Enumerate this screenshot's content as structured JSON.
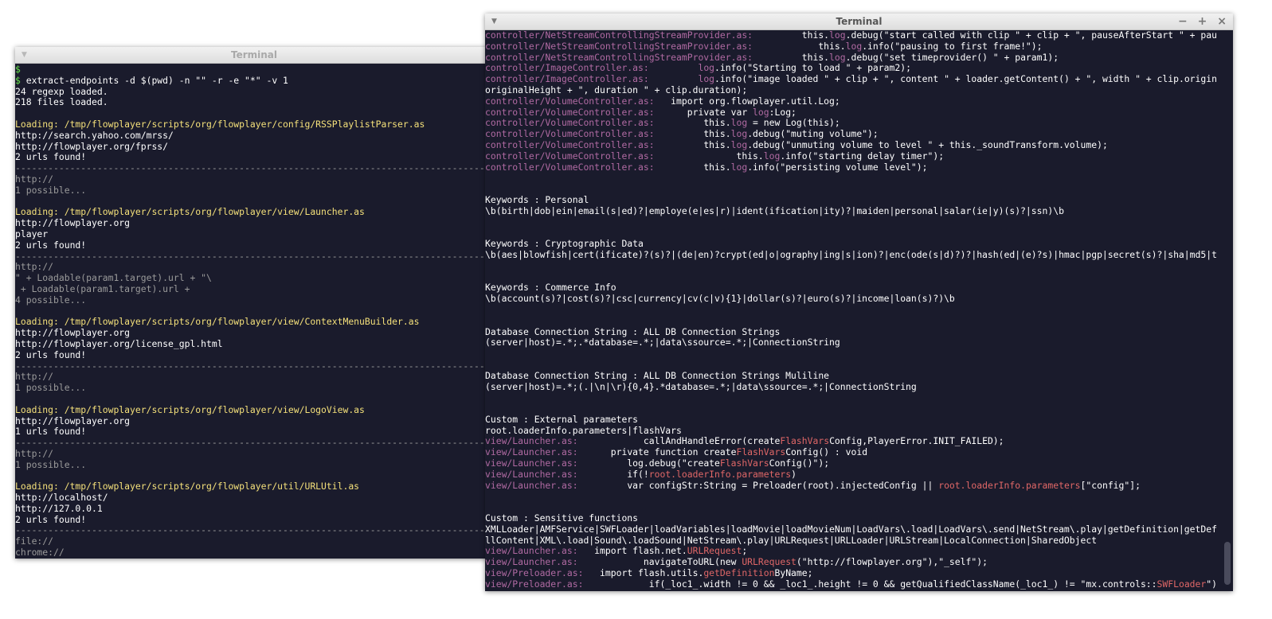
{
  "left_window": {
    "title": "Terminal",
    "lines": [
      {
        "segs": [
          {
            "t": "$",
            "c": "gr"
          }
        ]
      },
      {
        "segs": [
          {
            "t": "$",
            "c": "gr"
          },
          {
            "t": " extract-endpoints -d $(pwd) -n \"\" -r -e \"*\" -v 1"
          }
        ]
      },
      {
        "segs": [
          {
            "t": "24 regexp loaded."
          }
        ]
      },
      {
        "segs": [
          {
            "t": "218 files loaded."
          }
        ]
      },
      {
        "segs": [
          {
            "t": ""
          }
        ]
      },
      {
        "segs": [
          {
            "t": "Loading: /tmp/flowplayer/scripts/org/flowplayer/config/RSSPlaylistParser.as",
            "c": "y"
          }
        ]
      },
      {
        "segs": [
          {
            "t": "http://search.yahoo.com/mrss/"
          }
        ]
      },
      {
        "segs": [
          {
            "t": "http://flowplayer.org/fprss/"
          }
        ]
      },
      {
        "segs": [
          {
            "t": "2 urls found!"
          }
        ]
      },
      {
        "segs": [
          {
            "t": "--------------------------------------------------------------------------------------------------",
            "c": "g"
          }
        ]
      },
      {
        "segs": [
          {
            "t": "http://",
            "c": "g"
          }
        ]
      },
      {
        "segs": [
          {
            "t": "1 possible...",
            "c": "g"
          }
        ]
      },
      {
        "segs": [
          {
            "t": ""
          }
        ]
      },
      {
        "segs": [
          {
            "t": "Loading: /tmp/flowplayer/scripts/org/flowplayer/view/Launcher.as",
            "c": "y"
          }
        ]
      },
      {
        "segs": [
          {
            "t": "http://flowplayer.org"
          }
        ]
      },
      {
        "segs": [
          {
            "t": "player"
          }
        ]
      },
      {
        "segs": [
          {
            "t": "2 urls found!"
          }
        ]
      },
      {
        "segs": [
          {
            "t": "--------------------------------------------------------------------------------------------------",
            "c": "g"
          }
        ]
      },
      {
        "segs": [
          {
            "t": "http://",
            "c": "g"
          }
        ]
      },
      {
        "segs": [
          {
            "t": "\" + Loadable(param1.target).url + \"\\",
            "c": "g"
          }
        ]
      },
      {
        "segs": [
          {
            "t": " + Loadable(param1.target).url +",
            "c": "g"
          }
        ]
      },
      {
        "segs": [
          {
            "t": "4 possible...",
            "c": "g"
          }
        ]
      },
      {
        "segs": [
          {
            "t": ""
          }
        ]
      },
      {
        "segs": [
          {
            "t": "Loading: /tmp/flowplayer/scripts/org/flowplayer/view/ContextMenuBuilder.as",
            "c": "y"
          }
        ]
      },
      {
        "segs": [
          {
            "t": "http://flowplayer.org"
          }
        ]
      },
      {
        "segs": [
          {
            "t": "http://flowplayer.org/license_gpl.html"
          }
        ]
      },
      {
        "segs": [
          {
            "t": "2 urls found!"
          }
        ]
      },
      {
        "segs": [
          {
            "t": "--------------------------------------------------------------------------------------------------",
            "c": "g"
          }
        ]
      },
      {
        "segs": [
          {
            "t": "http://",
            "c": "g"
          }
        ]
      },
      {
        "segs": [
          {
            "t": "1 possible...",
            "c": "g"
          }
        ]
      },
      {
        "segs": [
          {
            "t": ""
          }
        ]
      },
      {
        "segs": [
          {
            "t": "Loading: /tmp/flowplayer/scripts/org/flowplayer/view/LogoView.as",
            "c": "y"
          }
        ]
      },
      {
        "segs": [
          {
            "t": "http://flowplayer.org"
          }
        ]
      },
      {
        "segs": [
          {
            "t": "1 urls found!"
          }
        ]
      },
      {
        "segs": [
          {
            "t": "--------------------------------------------------------------------------------------------------",
            "c": "g"
          }
        ]
      },
      {
        "segs": [
          {
            "t": "http://",
            "c": "g"
          }
        ]
      },
      {
        "segs": [
          {
            "t": "1 possible...",
            "c": "g"
          }
        ]
      },
      {
        "segs": [
          {
            "t": ""
          }
        ]
      },
      {
        "segs": [
          {
            "t": "Loading: /tmp/flowplayer/scripts/org/flowplayer/util/URLUtil.as",
            "c": "y"
          }
        ]
      },
      {
        "segs": [
          {
            "t": "http://localhost/"
          }
        ]
      },
      {
        "segs": [
          {
            "t": "http://127.0.0.1"
          }
        ]
      },
      {
        "segs": [
          {
            "t": "2 urls found!"
          }
        ]
      },
      {
        "segs": [
          {
            "t": "--------------------------------------------------------------------------------------------------",
            "c": "g"
          }
        ]
      },
      {
        "segs": [
          {
            "t": "file://",
            "c": "g"
          }
        ]
      },
      {
        "segs": [
          {
            "t": "chrome://",
            "c": "g"
          }
        ]
      }
    ]
  },
  "right_window": {
    "title": "Terminal",
    "controls": {
      "minimize": "−",
      "maximize": "+",
      "close": "×"
    },
    "lines": [
      {
        "segs": [
          {
            "t": "controller/NetStreamControllingStreamProvider.as:",
            "c": "m"
          },
          {
            "t": "         this."
          },
          {
            "t": "log",
            "c": "m"
          },
          {
            "t": ".debug(\"start called with clip \" + clip + \", pauseAfterStart \" + pau"
          }
        ]
      },
      {
        "segs": [
          {
            "t": "controller/NetStreamControllingStreamProvider.as:",
            "c": "m"
          },
          {
            "t": "            this."
          },
          {
            "t": "log",
            "c": "m"
          },
          {
            "t": ".info(\"pausing to first frame!\");"
          }
        ]
      },
      {
        "segs": [
          {
            "t": "controller/NetStreamControllingStreamProvider.as:",
            "c": "m"
          },
          {
            "t": "         this."
          },
          {
            "t": "log",
            "c": "m"
          },
          {
            "t": ".debug(\"set timeprovider() \" + param1);"
          }
        ]
      },
      {
        "segs": [
          {
            "t": "controller/ImageController.as:",
            "c": "m"
          },
          {
            "t": "         "
          },
          {
            "t": "log",
            "c": "m"
          },
          {
            "t": ".info(\"Starting to load \" + param2);"
          }
        ]
      },
      {
        "segs": [
          {
            "t": "controller/ImageController.as:",
            "c": "m"
          },
          {
            "t": "         "
          },
          {
            "t": "log",
            "c": "m"
          },
          {
            "t": ".info(\"image loaded \" + clip + \", content \" + loader.getContent() + \", width \" + clip.origin"
          }
        ]
      },
      {
        "segs": [
          {
            "t": "originalHeight + \", duration \" + clip.duration);"
          }
        ]
      },
      {
        "segs": [
          {
            "t": "controller/VolumeController.as:",
            "c": "m"
          },
          {
            "t": "   import org.flowplayer.util.Log;"
          }
        ]
      },
      {
        "segs": [
          {
            "t": "controller/VolumeController.as:",
            "c": "m"
          },
          {
            "t": "      private var "
          },
          {
            "t": "log",
            "c": "m"
          },
          {
            "t": ":Log;"
          }
        ]
      },
      {
        "segs": [
          {
            "t": "controller/VolumeController.as:",
            "c": "m"
          },
          {
            "t": "         this."
          },
          {
            "t": "log",
            "c": "m"
          },
          {
            "t": " = new Log(this);"
          }
        ]
      },
      {
        "segs": [
          {
            "t": "controller/VolumeController.as:",
            "c": "m"
          },
          {
            "t": "         this."
          },
          {
            "t": "log",
            "c": "m"
          },
          {
            "t": ".debug(\"muting volume\");"
          }
        ]
      },
      {
        "segs": [
          {
            "t": "controller/VolumeController.as:",
            "c": "m"
          },
          {
            "t": "         this."
          },
          {
            "t": "log",
            "c": "m"
          },
          {
            "t": ".debug(\"unmuting volume to level \" + this._soundTransform.volume);"
          }
        ]
      },
      {
        "segs": [
          {
            "t": "controller/VolumeController.as:",
            "c": "m"
          },
          {
            "t": "               this."
          },
          {
            "t": "log",
            "c": "m"
          },
          {
            "t": ".info(\"starting delay timer\");"
          }
        ]
      },
      {
        "segs": [
          {
            "t": "controller/VolumeController.as:",
            "c": "m"
          },
          {
            "t": "         this."
          },
          {
            "t": "log",
            "c": "m"
          },
          {
            "t": ".info(\"persisting volume level\");"
          }
        ]
      },
      {
        "segs": [
          {
            "t": ""
          }
        ]
      },
      {
        "segs": [
          {
            "t": ""
          }
        ]
      },
      {
        "segs": [
          {
            "t": "Keywords : Personal"
          }
        ]
      },
      {
        "segs": [
          {
            "t": "\\b(birth|dob|ein|email(s|ed)?|employe(e|es|r)|ident(ification|ity)?|maiden|personal|salar(ie|y)(s)?|ssn)\\b"
          }
        ]
      },
      {
        "segs": [
          {
            "t": ""
          }
        ]
      },
      {
        "segs": [
          {
            "t": ""
          }
        ]
      },
      {
        "segs": [
          {
            "t": "Keywords : Cryptographic Data"
          }
        ]
      },
      {
        "segs": [
          {
            "t": "\\b(aes|blowfish|cert(ificate)?(s)?|(de|en)?crypt(ed|o|ography|ing|s|ion)?|enc(ode(s|d)?)?|hash(ed|(e)?s)|hmac|pgp|secret(s)?|sha|md5|t"
          }
        ]
      },
      {
        "segs": [
          {
            "t": ""
          }
        ]
      },
      {
        "segs": [
          {
            "t": ""
          }
        ]
      },
      {
        "segs": [
          {
            "t": "Keywords : Commerce Info"
          }
        ]
      },
      {
        "segs": [
          {
            "t": "\\b(account(s)?|cost(s)?|csc|currency|cv(c|v){1}|dollar(s)?|euro(s)?|income|loan(s)?)\\b"
          }
        ]
      },
      {
        "segs": [
          {
            "t": ""
          }
        ]
      },
      {
        "segs": [
          {
            "t": ""
          }
        ]
      },
      {
        "segs": [
          {
            "t": "Database Connection String : ALL DB Connection Strings"
          }
        ]
      },
      {
        "segs": [
          {
            "t": "(server|host)=.*;.*database=.*;|data\\ssource=.*;|ConnectionString"
          }
        ]
      },
      {
        "segs": [
          {
            "t": ""
          }
        ]
      },
      {
        "segs": [
          {
            "t": ""
          }
        ]
      },
      {
        "segs": [
          {
            "t": "Database Connection String : ALL DB Connection Strings Muliline"
          }
        ]
      },
      {
        "segs": [
          {
            "t": "(server|host)=.*;(.|\\n|\\r){0,4}.*database=.*;|data\\ssource=.*;|ConnectionString"
          }
        ]
      },
      {
        "segs": [
          {
            "t": ""
          }
        ]
      },
      {
        "segs": [
          {
            "t": ""
          }
        ]
      },
      {
        "segs": [
          {
            "t": "Custom : External parameters"
          }
        ]
      },
      {
        "segs": [
          {
            "t": "root.loaderInfo.parameters|flashVars"
          }
        ]
      },
      {
        "segs": [
          {
            "t": "view/Launcher.as:",
            "c": "m"
          },
          {
            "t": "            callAndHandleError(create"
          },
          {
            "t": "FlashVars",
            "c": "r"
          },
          {
            "t": "Config,PlayerError.INIT_FAILED);"
          }
        ]
      },
      {
        "segs": [
          {
            "t": "view/Launcher.as:",
            "c": "m"
          },
          {
            "t": "      private function create"
          },
          {
            "t": "FlashVars",
            "c": "r"
          },
          {
            "t": "Config() : void"
          }
        ]
      },
      {
        "segs": [
          {
            "t": "view/Launcher.as:",
            "c": "m"
          },
          {
            "t": "         log.debug(\"create"
          },
          {
            "t": "FlashVars",
            "c": "r"
          },
          {
            "t": "Config()\");"
          }
        ]
      },
      {
        "segs": [
          {
            "t": "view/Launcher.as:",
            "c": "m"
          },
          {
            "t": "         if(!"
          },
          {
            "t": "root.loaderInfo.parameters",
            "c": "r"
          },
          {
            "t": ")"
          }
        ]
      },
      {
        "segs": [
          {
            "t": "view/Launcher.as:",
            "c": "m"
          },
          {
            "t": "         var configStr:String = Preloader(root).injectedConfig || "
          },
          {
            "t": "root.loaderInfo.parameters",
            "c": "r"
          },
          {
            "t": "[\"config\"];"
          }
        ]
      },
      {
        "segs": [
          {
            "t": ""
          }
        ]
      },
      {
        "segs": [
          {
            "t": ""
          }
        ]
      },
      {
        "segs": [
          {
            "t": "Custom : Sensitive functions"
          }
        ]
      },
      {
        "segs": [
          {
            "t": "XMLLoader|AMFService|SWFLoader|loadVariables|loadMovie|loadMovieNum|LoadVars\\.load|LoadVars\\.send|NetStream\\.play|getDefinition|getDef"
          }
        ]
      },
      {
        "segs": [
          {
            "t": "llContent|XML\\.load|Sound\\.loadSound|NetStream\\.play|URLRequest|URLLoader|URLStream|LocalConnection|SharedObject"
          }
        ]
      },
      {
        "segs": [
          {
            "t": "view/Launcher.as:",
            "c": "m"
          },
          {
            "t": "   import flash.net."
          },
          {
            "t": "URLRequest",
            "c": "r"
          },
          {
            "t": ";"
          }
        ]
      },
      {
        "segs": [
          {
            "t": "view/Launcher.as:",
            "c": "m"
          },
          {
            "t": "            navigateToURL(new "
          },
          {
            "t": "URLRequest",
            "c": "r"
          },
          {
            "t": "(\"http://flowplayer.org\"),\"_self\");"
          }
        ]
      },
      {
        "segs": [
          {
            "t": "view/Preloader.as:",
            "c": "m"
          },
          {
            "t": "   import flash.utils."
          },
          {
            "t": "getDefinition",
            "c": "r"
          },
          {
            "t": "ByName;"
          }
        ]
      },
      {
        "segs": [
          {
            "t": "view/Preloader.as:",
            "c": "m"
          },
          {
            "t": "            if(_loc1_.width != 0 && _loc1_.height != 0 && getQualifiedClassName(_loc1_) != \"mx.controls::"
          },
          {
            "t": "SWFLoader",
            "c": "r"
          },
          {
            "t": "\")"
          }
        ]
      }
    ]
  }
}
